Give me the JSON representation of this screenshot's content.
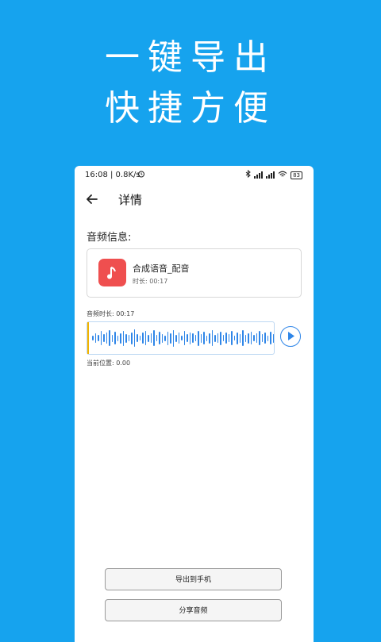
{
  "promo": {
    "line1": "一键导出",
    "line2": "快捷方便"
  },
  "statusbar": {
    "time": "16:08 | 0.8K/s",
    "battery": "83"
  },
  "header": {
    "title": "详情"
  },
  "audio_info": {
    "section_label": "音频信息:",
    "name": "合成语音_配音",
    "duration": "时长: 00:17"
  },
  "player": {
    "audio_length": "音频时长: 00:17",
    "position": "当前位置: 0.00"
  },
  "actions": {
    "export_label": "导出到手机",
    "share_label": "分享音频"
  },
  "colors": {
    "background": "#16a3ee",
    "accent": "#2f86e8",
    "music_tile": "#ef4f4f",
    "cursor": "#f2b400"
  }
}
